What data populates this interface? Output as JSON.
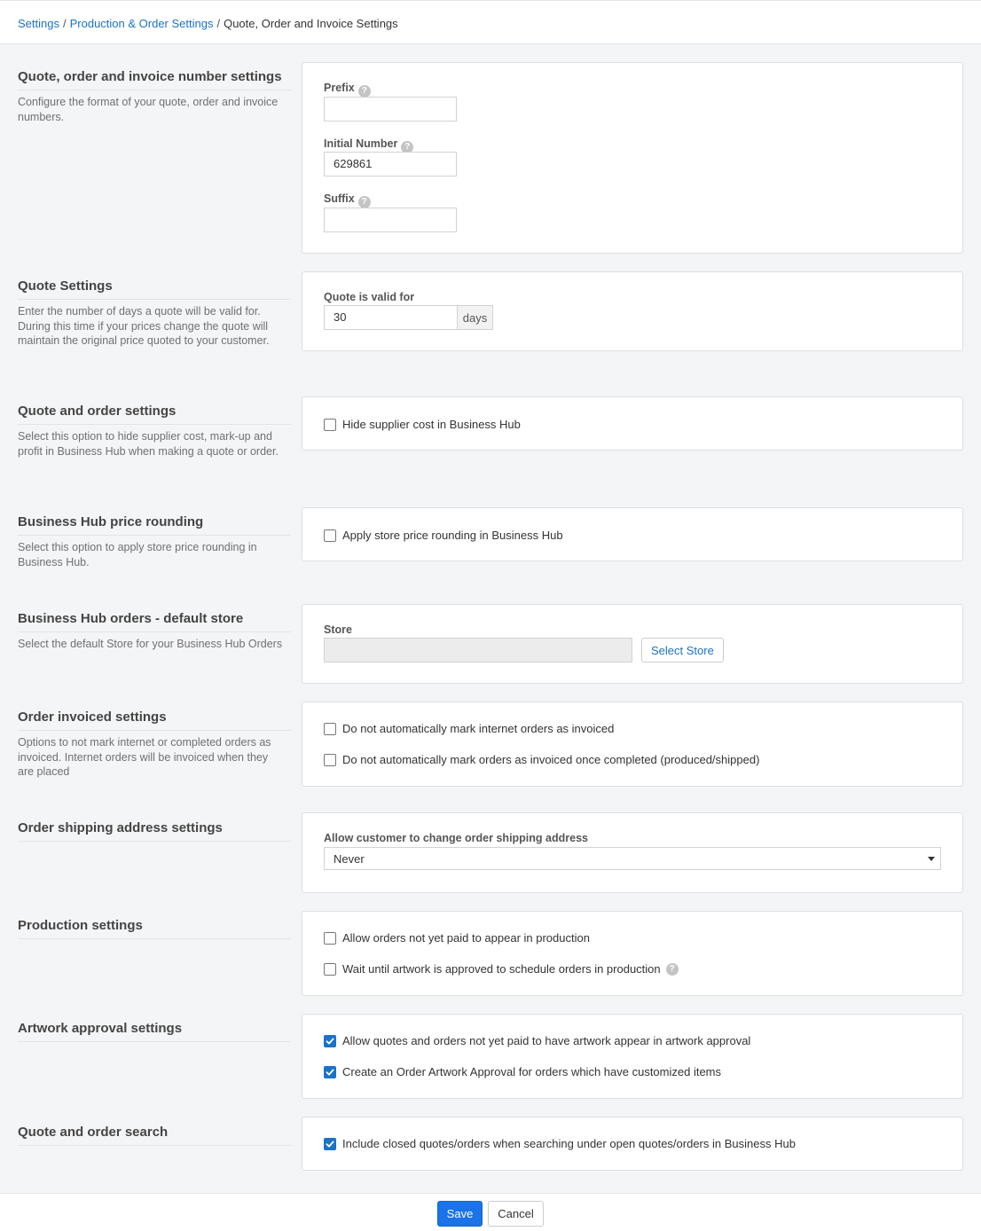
{
  "breadcrumb": {
    "items": [
      "Settings",
      "Production & Order Settings"
    ],
    "current": "Quote, Order and Invoice Settings",
    "separator": "/"
  },
  "sections": {
    "numbering": {
      "title": "Quote, order and invoice number settings",
      "description": "Configure the format of your quote, order and invoice numbers.",
      "prefix_label": "Prefix",
      "prefix_value": "",
      "initial_label": "Initial Number",
      "initial_value": "629861",
      "suffix_label": "Suffix",
      "suffix_value": ""
    },
    "quote": {
      "title": "Quote Settings",
      "description": "Enter the number of days a quote will be valid for. During this time if your prices change the quote will maintain the original price quoted to your customer.",
      "valid_label": "Quote is valid for",
      "valid_value": "30",
      "valid_unit": "days"
    },
    "quote_order": {
      "title": "Quote and order settings",
      "description": "Select this option to hide supplier cost, mark-up and profit in Business Hub when making a quote or order.",
      "hide_cost_label": "Hide supplier cost in Business Hub",
      "hide_cost_checked": false
    },
    "rounding": {
      "title": "Business Hub price rounding",
      "description": "Select this option to apply store price rounding in Business Hub.",
      "apply_label": "Apply store price rounding in Business Hub",
      "apply_checked": false
    },
    "default_store": {
      "title": "Business Hub orders - default store",
      "description": "Select the default Store for your Business Hub Orders",
      "store_label": "Store",
      "store_value": "",
      "select_button": "Select Store"
    },
    "invoiced": {
      "title": "Order invoiced settings",
      "description": "Options to not mark internet or completed orders as invoiced. Internet orders will be invoiced when they are placed",
      "opt1_label": "Do not automatically mark internet orders as invoiced",
      "opt1_checked": false,
      "opt2_label": "Do not automatically mark orders as invoiced once completed (produced/shipped)",
      "opt2_checked": false
    },
    "shipping": {
      "title": "Order shipping address settings",
      "allow_label": "Allow customer to change order shipping address",
      "allow_value": "Never"
    },
    "production": {
      "title": "Production settings",
      "opt1_label": "Allow orders not yet paid to appear in production",
      "opt1_checked": false,
      "opt2_label": "Wait until artwork is approved to schedule orders in production",
      "opt2_checked": false
    },
    "artwork": {
      "title": "Artwork approval settings",
      "opt1_label": "Allow quotes and orders not yet paid to have artwork appear in artwork approval",
      "opt1_checked": true,
      "opt2_label": "Create an Order Artwork Approval for orders which have customized items",
      "opt2_checked": true
    },
    "search": {
      "title": "Quote and order search",
      "opt1_label": "Include closed quotes/orders when searching under open quotes/orders in Business Hub",
      "opt1_checked": true
    }
  },
  "footer": {
    "save_label": "Save",
    "cancel_label": "Cancel"
  },
  "colors": {
    "link": "#1a73c8",
    "primary": "#1a73e8",
    "background": "#f4f5f7"
  },
  "icons": {
    "help": "question-circle-icon",
    "check": "checkmark-icon",
    "caret": "caret-down-icon"
  }
}
